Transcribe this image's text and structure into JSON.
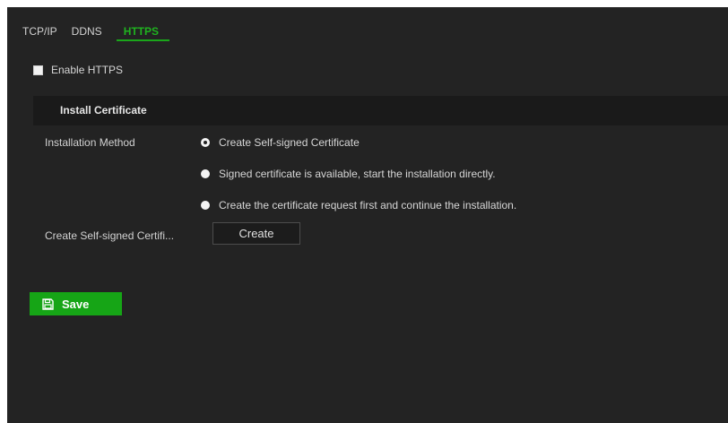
{
  "tabs": [
    {
      "label": "TCP/IP",
      "active": false
    },
    {
      "label": "DDNS",
      "active": false
    },
    {
      "label": "HTTPS",
      "active": true
    }
  ],
  "enable_https": {
    "label": "Enable HTTPS",
    "checked": false
  },
  "section": {
    "title": "Install Certificate"
  },
  "installation_method": {
    "label": "Installation Method",
    "options": [
      {
        "label": "Create Self-signed Certificate",
        "selected": true
      },
      {
        "label": "Signed certificate is available, start the installation directly.",
        "selected": false
      },
      {
        "label": "Create the certificate request first and continue the installation.",
        "selected": false
      }
    ]
  },
  "self_signed": {
    "label": "Create Self-signed Certifi...",
    "button_label": "Create"
  },
  "save": {
    "label": "Save",
    "icon": "floppy-disk-icon"
  },
  "colors": {
    "background": "#232323",
    "section_header": "#1a1a1a",
    "accent_green": "#16a516",
    "active_tab": "#1fb31f",
    "text": "#d6d6d6"
  }
}
